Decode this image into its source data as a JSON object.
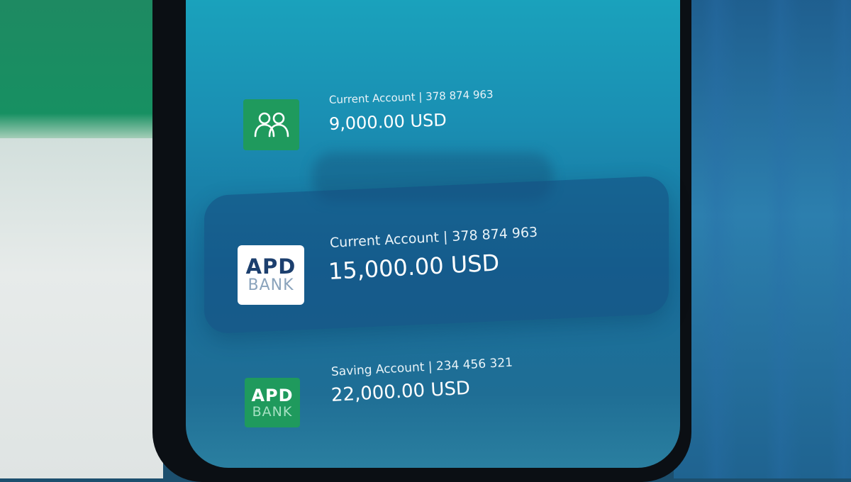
{
  "accounts": [
    {
      "label": "Current Account | 378 874 963",
      "amount": "9,000.00 USD",
      "icon": "people-icon",
      "logo_color": "#1f9a5d"
    },
    {
      "label": "Current Account | 378 874 963",
      "amount": "15,000.00 USD",
      "logo_line1": "APD",
      "logo_line2": "BANK",
      "logo_color": "#ffffff",
      "selected": true
    },
    {
      "label": "Saving Account | 234 456 321",
      "amount": "22,000.00 USD",
      "logo_line1": "APD",
      "logo_line2": "BANK",
      "logo_color": "#1f9a5d"
    }
  ],
  "colors": {
    "screen_gradient_top": "#1aa6be",
    "screen_gradient_bottom": "#18709d",
    "selected_card": "#144b7d",
    "logo_green": "#1f9a5d",
    "logo_navy": "#1c3f6e"
  }
}
